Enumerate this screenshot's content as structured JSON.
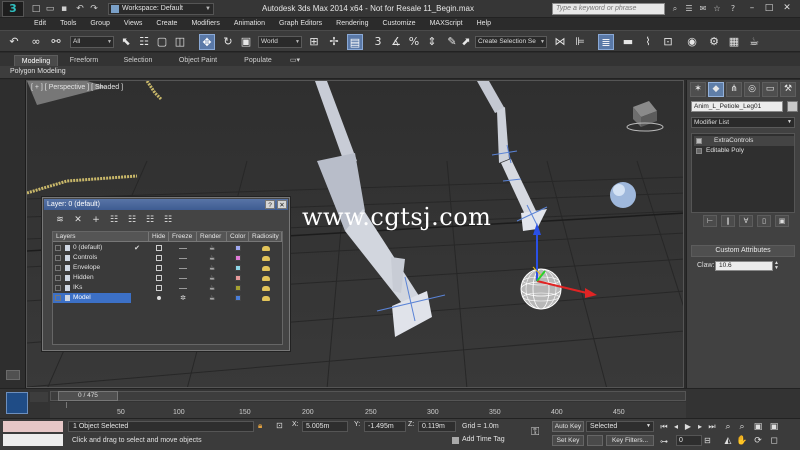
{
  "title_bar": {
    "logo": "3",
    "workspace": "Workspace: Default",
    "window_title": "Autodesk 3ds Max  2014 x64  - Not for Resale   11_Begin.max",
    "search_placeholder": "Type a keyword or phrase"
  },
  "menu": [
    "Edit",
    "Tools",
    "Group",
    "Views",
    "Create",
    "Modifiers",
    "Animation",
    "Graph Editors",
    "Rendering",
    "Customize",
    "MAXScript",
    "Help"
  ],
  "toolbar": {
    "selection_filter": "All",
    "coord_system": "World",
    "snap_label": "3",
    "named_selection": "Create Selection Se"
  },
  "ribbon": {
    "tabs": [
      "Modeling",
      "Freeform",
      "Selection",
      "Object Paint",
      "Populate"
    ],
    "panel_label": "Polygon Modeling"
  },
  "viewport": {
    "label": "[ + ] [ Perspective ] [ Shaded ]",
    "watermark": "www.cgtsj.com"
  },
  "command_panel": {
    "object_name": "Anim_L_Petiole_Leg01",
    "modifier_list": "Modifier List",
    "stack": [
      "ExtraControls",
      "Editable Poly"
    ],
    "rollout_title": "Custom Attributes",
    "claw_label": "Claw:",
    "claw_value": "10.6"
  },
  "layer_dialog": {
    "title": "Layer: 0 (default)",
    "columns": [
      "Layers",
      "Hide",
      "Freeze",
      "Render",
      "Color",
      "Radiosity"
    ],
    "rows": [
      {
        "name": "0 (default)",
        "color": "#9fa8f0",
        "current": true
      },
      {
        "name": "Controls",
        "color": "#e07bd8"
      },
      {
        "name": "Envelope",
        "color": "#8fd7e8"
      },
      {
        "name": "Hidden",
        "color": "#e89a9a"
      },
      {
        "name": "IKs",
        "color": "#a6a230"
      },
      {
        "name": "Model",
        "color": "#4a7ed8",
        "selected": true
      }
    ]
  },
  "timeline": {
    "frame_indicator": "0 / 475",
    "ticks": [
      "50",
      "100",
      "150",
      "200",
      "250",
      "300",
      "350",
      "400",
      "450"
    ]
  },
  "status": {
    "selection_count": "1 Object Selected",
    "prompt": "Click and drag to select and move objects",
    "x_label": "X:",
    "x_value": "5.005m",
    "y_label": "Y:",
    "y_value": "-1.495m",
    "z_label": "Z:",
    "z_value": "0.119m",
    "grid": "Grid = 1.0m",
    "add_time_tag": "Add Time Tag",
    "auto_key": "Auto Key",
    "set_key": "Set Key",
    "key_mode": "Selected",
    "key_filters": "Key Filters...",
    "current_frame": "0"
  }
}
